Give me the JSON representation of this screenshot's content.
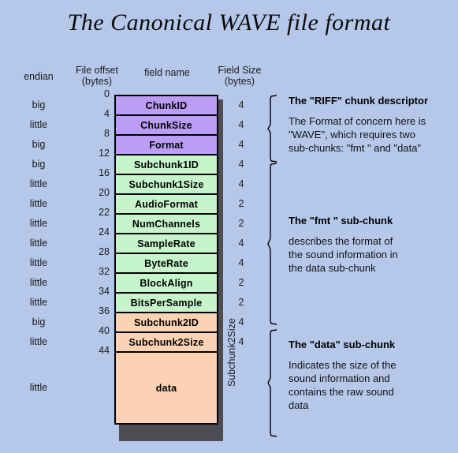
{
  "title": "The Canonical WAVE file format",
  "columns": {
    "endian": "endian",
    "offset_line1": "File offset",
    "offset_line2": "(bytes)",
    "field_name": "field name",
    "size_line1": "Field Size",
    "size_line2": "(bytes)"
  },
  "colors": {
    "background": "#b6c8ea",
    "riff_chunk": "#bb9df5",
    "fmt_chunk": "#c6f5cc",
    "data_chunk": "#fbd2b3",
    "shadow": "#4d4d52",
    "border": "#000000"
  },
  "rows": [
    {
      "endian": "big",
      "offset": "0",
      "field": "ChunkID",
      "size": "4",
      "group": "riff"
    },
    {
      "endian": "little",
      "offset": "4",
      "field": "ChunkSize",
      "size": "4",
      "group": "riff"
    },
    {
      "endian": "big",
      "offset": "8",
      "field": "Format",
      "size": "4",
      "group": "riff"
    },
    {
      "endian": "big",
      "offset": "12",
      "field": "Subchunk1ID",
      "size": "4",
      "group": "fmt"
    },
    {
      "endian": "little",
      "offset": "16",
      "field": "Subchunk1Size",
      "size": "4",
      "group": "fmt"
    },
    {
      "endian": "little",
      "offset": "20",
      "field": "AudioFormat",
      "size": "2",
      "group": "fmt"
    },
    {
      "endian": "little",
      "offset": "22",
      "field": "NumChannels",
      "size": "2",
      "group": "fmt"
    },
    {
      "endian": "little",
      "offset": "24",
      "field": "SampleRate",
      "size": "4",
      "group": "fmt"
    },
    {
      "endian": "little",
      "offset": "28",
      "field": "ByteRate",
      "size": "4",
      "group": "fmt"
    },
    {
      "endian": "little",
      "offset": "32",
      "field": "BlockAlign",
      "size": "2",
      "group": "fmt"
    },
    {
      "endian": "little",
      "offset": "34",
      "field": "BitsPerSample",
      "size": "2",
      "group": "fmt"
    },
    {
      "endian": "big",
      "offset": "36",
      "field": "Subchunk2ID",
      "size": "4",
      "group": "data"
    },
    {
      "endian": "little",
      "offset": "40",
      "field": "Subchunk2Size",
      "size": "4",
      "group": "data"
    },
    {
      "endian": "little",
      "offset": "44",
      "field": "data",
      "size": "",
      "group": "data"
    }
  ],
  "vertical_label": "Subchunk2Size",
  "notes": {
    "riff": {
      "title": "The \"RIFF\" chunk descriptor",
      "body": [
        "The Format of concern here is",
        "\"WAVE\", which requires two",
        "sub-chunks: \"fmt \" and \"data\""
      ]
    },
    "fmt": {
      "title": "The \"fmt \" sub-chunk",
      "body": [
        "describes the format of",
        "the sound information in",
        "the data sub-chunk"
      ]
    },
    "data": {
      "title": "The \"data\" sub-chunk",
      "body": [
        "Indicates the size of the",
        "sound information and",
        "contains the raw sound",
        "data"
      ]
    }
  }
}
